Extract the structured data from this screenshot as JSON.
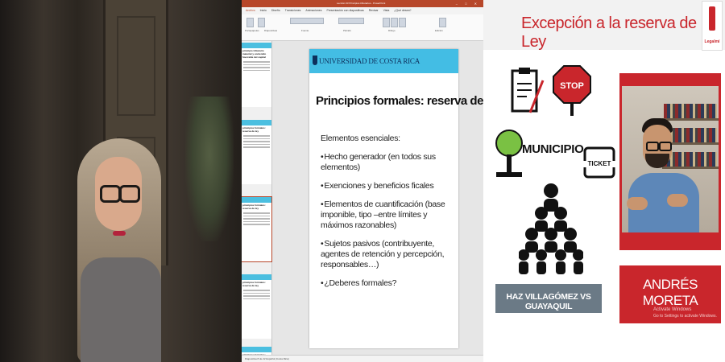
{
  "webcam_left": {
    "description_icon": "person-icon"
  },
  "powerpoint": {
    "window_title": "Lección 03 Principios tributarios - PowerPoint",
    "window_controls": "–  □  ✕",
    "tabs": [
      {
        "label": "Archivo"
      },
      {
        "label": "Inicio"
      },
      {
        "label": "Diseño"
      },
      {
        "label": "Transiciones"
      },
      {
        "label": "Animaciones"
      },
      {
        "label": "Presentación con diapositivas"
      },
      {
        "label": "Revisar"
      },
      {
        "label": "Vista"
      },
      {
        "label": "¿Qué desea?"
      }
    ],
    "ribbon_groups": [
      "Portapapeles",
      "Diapositivas",
      "Fuente",
      "Párrafo",
      "Dibujo",
      "Edición"
    ],
    "thumbnails": [
      {
        "title": "principio tributario material y contenido favorable del capital"
      },
      {
        "title": "principios formales: reserva de ley"
      },
      {
        "title": "principios formales: reserva de ley"
      },
      {
        "title": "principios formales: reserva de ley"
      },
      {
        "title": "principios formales: reserva de ley"
      }
    ],
    "slide": {
      "logo_text": "UNIVERSIDAD DE COSTA RICA",
      "title": "Principios formales: reserva de ley",
      "intro": "Elementos esenciales:",
      "bullets": [
        "Hecho generador (en todos sus elementos)",
        "Exenciones y beneficios ficales",
        "Elementos de cuantificación (base imponible, tipo –entre límites y máximos razonables)",
        "Sujetos pasivos (contribuyente, agentes de retención y percepción, responsables…)",
        "¿Deberes formales?"
      ]
    },
    "status": "Diapositiva 8 de 22   Español (Costa Rica)"
  },
  "presenter": {
    "title": "Excepción a la reserva de Ley",
    "brand": "Legalmí",
    "municipio": "MUNICIPIO",
    "stop_text": "STOP",
    "ticket_text": "TICKET",
    "case": "HAZ VILLAGÓMEZ VS GUAYAQUIL",
    "name": "ANDRÉS MORETA",
    "watermark1": "Activate Windows",
    "watermark2": "Go to Settings to activate Windows.",
    "accent_color": "#c9262c"
  }
}
